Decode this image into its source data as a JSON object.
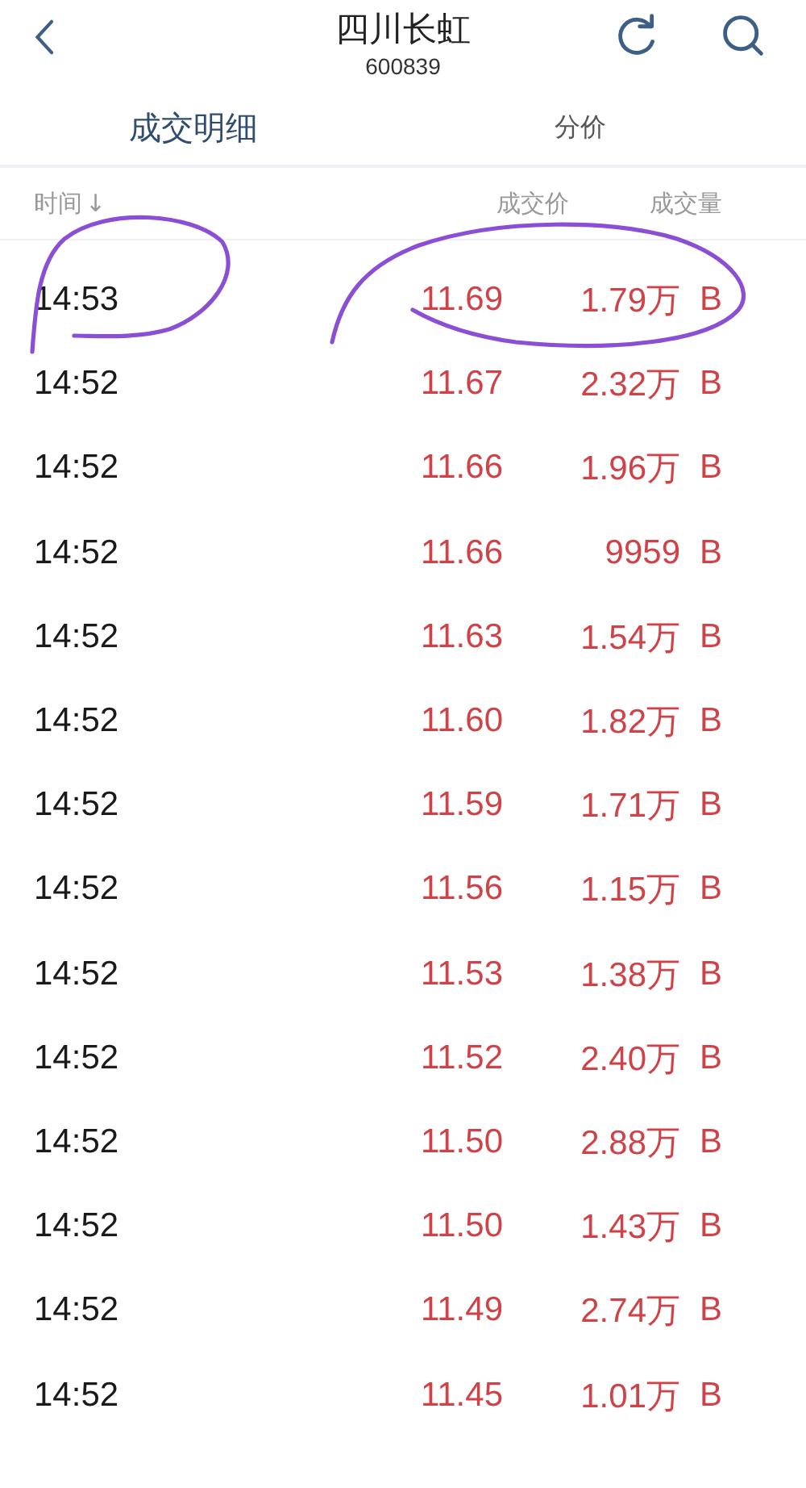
{
  "header": {
    "title": "四川长虹",
    "code": "600839"
  },
  "tabs": [
    {
      "label": "成交明细",
      "selected": true
    },
    {
      "label": "分价",
      "selected": false
    }
  ],
  "columns": {
    "time": "时间",
    "time_sort": "↓",
    "price": "成交价",
    "volume": "成交量"
  },
  "rows": [
    {
      "time": "14:53",
      "price": "11.69",
      "volume": "1.79万",
      "side": "B"
    },
    {
      "time": "14:52",
      "price": "11.67",
      "volume": "2.32万",
      "side": "B"
    },
    {
      "time": "14:52",
      "price": "11.66",
      "volume": "1.96万",
      "side": "B"
    },
    {
      "time": "14:52",
      "price": "11.66",
      "volume": "9959",
      "side": "B"
    },
    {
      "time": "14:52",
      "price": "11.63",
      "volume": "1.54万",
      "side": "B"
    },
    {
      "time": "14:52",
      "price": "11.60",
      "volume": "1.82万",
      "side": "B"
    },
    {
      "time": "14:52",
      "price": "11.59",
      "volume": "1.71万",
      "side": "B"
    },
    {
      "time": "14:52",
      "price": "11.56",
      "volume": "1.15万",
      "side": "B"
    },
    {
      "time": "14:52",
      "price": "11.53",
      "volume": "1.38万",
      "side": "B"
    },
    {
      "time": "14:52",
      "price": "11.52",
      "volume": "2.40万",
      "side": "B"
    },
    {
      "time": "14:52",
      "price": "11.50",
      "volume": "2.88万",
      "side": "B"
    },
    {
      "time": "14:52",
      "price": "11.50",
      "volume": "1.43万",
      "side": "B"
    },
    {
      "time": "14:52",
      "price": "11.49",
      "volume": "2.74万",
      "side": "B"
    },
    {
      "time": "14:52",
      "price": "11.45",
      "volume": "1.01万",
      "side": "B"
    }
  ]
}
